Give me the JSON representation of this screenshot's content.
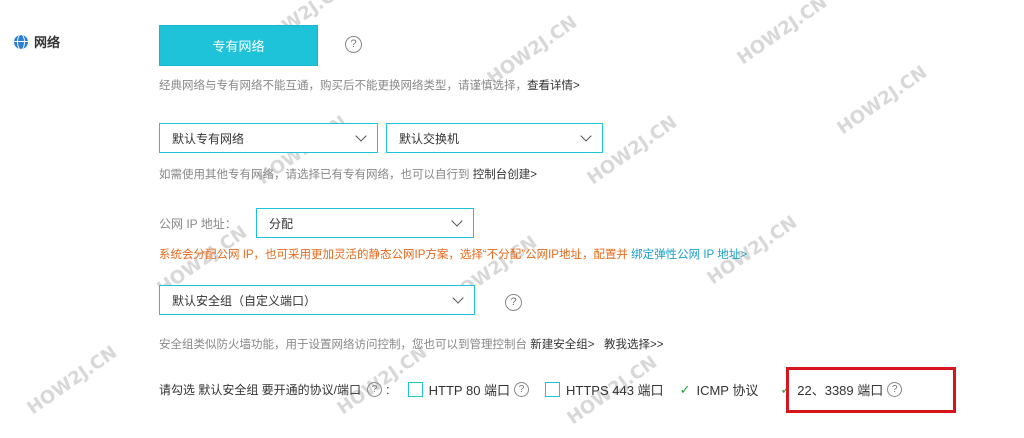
{
  "section": {
    "label": "网络",
    "icon": "globe-icon"
  },
  "network_type": {
    "selected_label": "专有网络",
    "help": "?"
  },
  "network_tip": {
    "text": "经典网络与专有网络不能互通，购买后不能更换网络类型，请谨慎选择，",
    "link": "查看详情>"
  },
  "vpc_select": {
    "value": "默认专有网络"
  },
  "vswitch_select": {
    "value": "默认交换机"
  },
  "vpc_tip": {
    "text": "如需使用其他专有网络，请选择已有专有网络，也可以自行到 ",
    "link": "控制台创建>"
  },
  "public_ip": {
    "label": "公网 IP 地址：",
    "value": "分配",
    "warning": "系统会分配公网 IP，也可采用更加灵活的静态公网IP方案，选择“不分配”公网IP地址，配置并 ",
    "warning_link": "绑定弹性公网 IP 地址>"
  },
  "security_group": {
    "value": "默认安全组（自定义端口）",
    "help": "?",
    "tip": "安全组类似防火墙功能，用于设置网络访问控制，您也可以到管理控制台 ",
    "tip_link1": "新建安全组>",
    "tip_link2": "教我选择>>"
  },
  "ports": {
    "prompt": "请勾选 默认安全组 要开通的协议/端口",
    "options": [
      {
        "label": "HTTP 80 端口",
        "checked": false
      },
      {
        "label": "HTTPS 443 端口",
        "checked": false
      },
      {
        "label": "ICMP 协议",
        "checked": true
      },
      {
        "label": "22、3389 端口",
        "checked": true
      }
    ]
  },
  "watermark": "HOW2J.CN"
}
